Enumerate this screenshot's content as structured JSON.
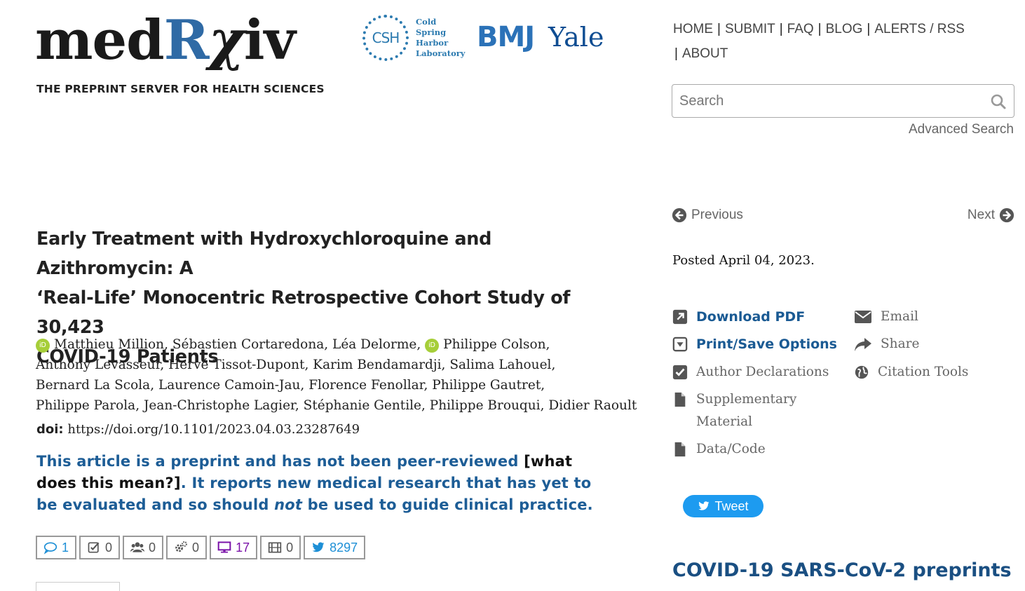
{
  "logo": {
    "med": "med",
    "r": "R",
    "chi": "χ",
    "iv": "iv",
    "tagline": "THE PREPRINT SERVER FOR HEALTH SCIENCES"
  },
  "partners": {
    "csh_badge": "CSH",
    "csh_lines": [
      "Cold",
      "Spring",
      "Harbor",
      "Laboratory"
    ],
    "bmj": "BMJ",
    "yale": "Yale"
  },
  "nav": {
    "home": "HOME",
    "submit": "SUBMIT",
    "faq": "FAQ",
    "blog": "BLOG",
    "alerts": "ALERTS / RSS",
    "about": "ABOUT",
    "separator": "|"
  },
  "search": {
    "placeholder": "Search",
    "advanced": "Advanced Search"
  },
  "pager": {
    "previous": "Previous",
    "next": "Next"
  },
  "posted": "Posted April 04, 2023.",
  "article": {
    "title_lines": [
      "Early Treatment with Hydroxychloroquine and Azithromycin: A",
      "‘Real-Life’ Monocentric Retrospective Cohort Study of 30,423",
      "COVID-19 Patients"
    ],
    "orcid_label": "iD",
    "authors": [
      "Matthieu Million,",
      "Sébastien Cortaredona,",
      "Léa Delorme,",
      "Philippe Colson,",
      "Anthony Levasseur,",
      "Hervé Tissot-Dupont,",
      "Karim Bendamardji,",
      "Salima Lahouel,",
      "Bernard La Scola,",
      "Laurence Camoin-Jau,",
      "Florence Fenollar,",
      "Philippe Gautret,",
      "Philippe Parola,",
      "Jean-Christophe Lagier,",
      "Stéphanie Gentile,",
      "Philippe Brouqui,",
      "Didier Raoult"
    ],
    "doi_label": "doi:",
    "doi_value": "https://doi.org/10.1101/2023.04.03.23287649",
    "notice": {
      "part1": "This article is a preprint and has not been peer-reviewed ",
      "bracket_open": "[",
      "link": "what does this mean?",
      "bracket_close": "]",
      "part2": ". It reports new medical research that has yet to be evaluated and so should ",
      "not": "not",
      "part3": " be used to guide clinical practice."
    }
  },
  "metrics": {
    "comments": "1",
    "reviews": "0",
    "community": "0",
    "automated": "0",
    "news": "17",
    "videos": "0",
    "tweets": "8297"
  },
  "tools": {
    "download_pdf": "Download PDF",
    "print_save": "Print/Save Options",
    "author_declarations": "Author Declarations",
    "supplementary": "Supplementary Material",
    "supplementary_line1": "Supplementary",
    "supplementary_line2": "Material",
    "data_code": "Data/Code",
    "email": "Email",
    "share": "Share",
    "citation_tools": "Citation Tools"
  },
  "tweet_button": "Tweet",
  "covid_heading": "COVID-19 SARS-CoV-2 preprints",
  "colors": {
    "brand_blue": "#1a5a93",
    "orcid_green": "#a6ce39",
    "twitter_blue": "#1d9bf0",
    "news_purple": "#7a12a8"
  }
}
